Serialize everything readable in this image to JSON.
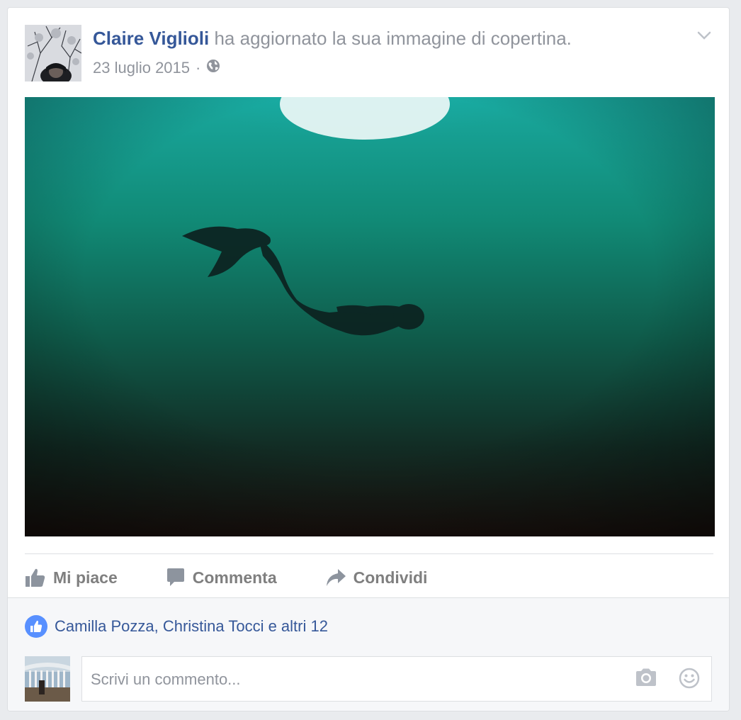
{
  "post": {
    "author": "Claire Viglioli",
    "action_text": " ha aggiornato la sua immagine di copertina.",
    "date": "23 luglio 2015",
    "separator": "·",
    "privacy_icon": "globe-icon",
    "menu_icon": "chevron-down-icon"
  },
  "actions": {
    "like_label": "Mi piace",
    "comment_label": "Commenta",
    "share_label": "Condividi"
  },
  "reactions": {
    "text": "Camilla Pozza, Christina Tocci e altri 12",
    "icon": "like-badge-icon"
  },
  "comment": {
    "placeholder": "Scrivi un commento...",
    "camera_icon": "camera-icon",
    "emoji_icon": "smiley-icon"
  },
  "colors": {
    "link_blue": "#365899",
    "muted_gray": "#90949c",
    "like_blue": "#5890ff",
    "footer_bg": "#f6f7f9"
  }
}
